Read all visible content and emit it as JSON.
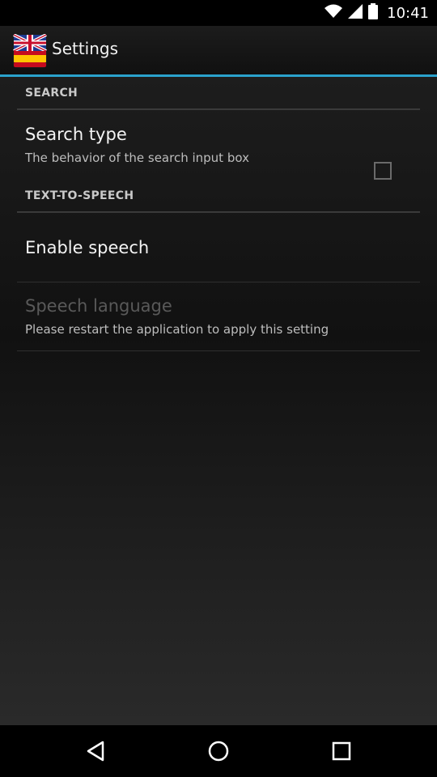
{
  "status_bar": {
    "time": "10:41",
    "icons": [
      "wifi-icon",
      "signal-icon",
      "battery-icon"
    ]
  },
  "action_bar": {
    "title": "Settings",
    "app_icon": "uk-spain-flag-icon"
  },
  "sections": {
    "search": {
      "header": "SEARCH",
      "search_type": {
        "title": "Search type",
        "summary": "The behavior of the search input box"
      }
    },
    "tts": {
      "header": "TEXT-TO-SPEECH",
      "enable_speech": {
        "title": "Enable speech",
        "checked": false
      },
      "speech_language": {
        "title": "Speech language",
        "summary": "Please restart the application to apply this setting",
        "enabled": false
      }
    }
  },
  "nav_bar": {
    "buttons": [
      "back-icon",
      "home-icon",
      "recents-icon"
    ]
  },
  "colors": {
    "accent": "#2aa2cc",
    "background": "#000000"
  }
}
